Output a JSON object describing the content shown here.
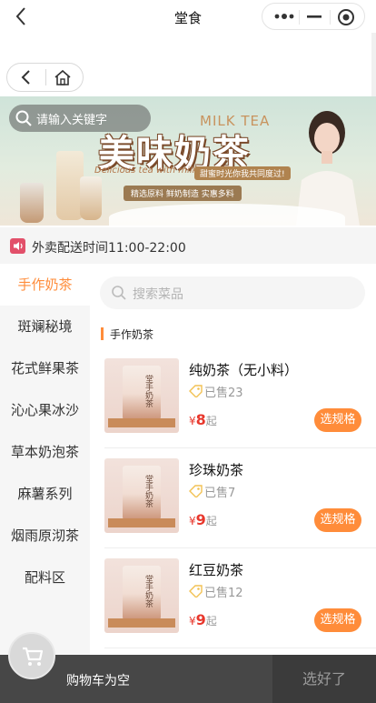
{
  "header": {
    "title": "堂食"
  },
  "banner": {
    "search_placeholder": "请输入关键字",
    "headline": "美味奶茶",
    "headline_en": "MILK TEA",
    "tagline_en": "Delicious tea with milk",
    "tagline_cn": "甜蜜时光你我共同度过!",
    "features": "精选原料 鲜奶制造 实惠多料"
  },
  "notice": {
    "text": "外卖配送时间11:00-22:00"
  },
  "categories": [
    {
      "label": "手作奶茶",
      "active": true
    },
    {
      "label": "斑斓秘境",
      "active": false
    },
    {
      "label": "花式鲜果茶",
      "active": false
    },
    {
      "label": "沁心果冰沙",
      "active": false
    },
    {
      "label": "草本奶泡茶",
      "active": false
    },
    {
      "label": "麻薯系列",
      "active": false
    },
    {
      "label": "烟雨原沏茶",
      "active": false
    },
    {
      "label": "配料区",
      "active": false
    }
  ],
  "dish_search": {
    "placeholder": "搜索菜品"
  },
  "section_title": "手作奶茶",
  "products": [
    {
      "name": "纯奶茶（无小料）",
      "sold": "已售23",
      "currency": "¥",
      "price": "8",
      "unit": "起",
      "button": "选规格",
      "cup_text": "堂手奶茶"
    },
    {
      "name": "珍珠奶茶",
      "sold": "已售7",
      "currency": "¥",
      "price": "9",
      "unit": "起",
      "button": "选规格",
      "cup_text": "堂手奶茶"
    },
    {
      "name": "红豆奶茶",
      "sold": "已售12",
      "currency": "¥",
      "price": "9",
      "unit": "起",
      "button": "选规格",
      "cup_text": "堂手奶茶"
    }
  ],
  "cart": {
    "empty_text": "购物车为空",
    "done_label": "选好了"
  },
  "colors": {
    "accent": "#ff8c3a",
    "price": "#e8372c",
    "cartbar": "#474747"
  },
  "icons": [
    "back-icon",
    "more-dots-icon",
    "minimize-icon",
    "target-icon",
    "chevron-left-icon",
    "home-icon",
    "search-icon",
    "speaker-icon",
    "tag-icon",
    "cart-icon"
  ]
}
